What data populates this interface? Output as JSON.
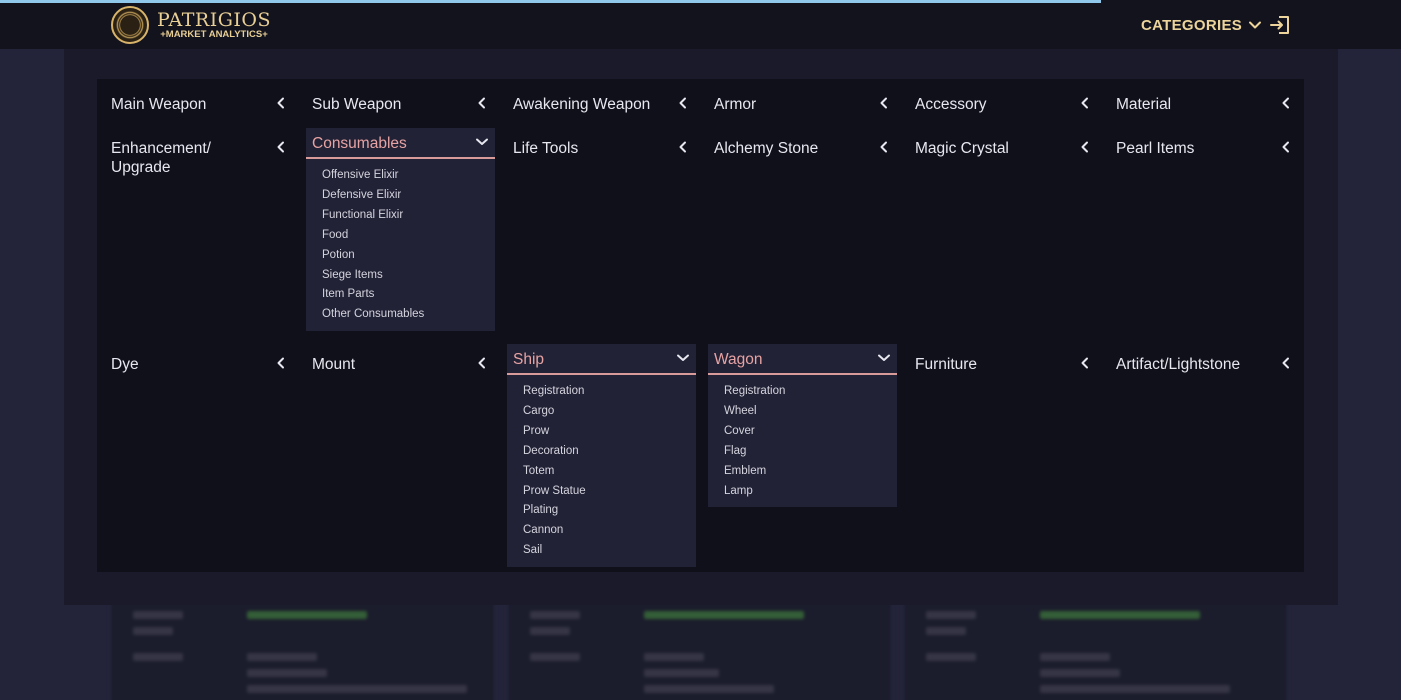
{
  "header": {
    "logo_title": "PATRIGIOS",
    "logo_subtitle": "+MARKET ANALYTICS+",
    "categories_label": "CATEGORIES",
    "progress": 0.786
  },
  "categories": [
    {
      "label": "Main Weapon"
    },
    {
      "label": "Sub Weapon"
    },
    {
      "label": "Awakening Weapon"
    },
    {
      "label": "Armor"
    },
    {
      "label": "Accessory"
    },
    {
      "label": "Material"
    },
    {
      "label": "Enhancement/\nUpgrade"
    },
    {
      "label": "Consumables",
      "open": true,
      "items": [
        "Offensive Elixir",
        "Defensive Elixir",
        "Functional Elixir",
        "Food",
        "Potion",
        "Siege Items",
        "Item Parts",
        "Other Consumables"
      ]
    },
    {
      "label": "Life Tools"
    },
    {
      "label": "Alchemy Stone"
    },
    {
      "label": "Magic Crystal"
    },
    {
      "label": "Pearl Items"
    },
    {
      "label": "Dye"
    },
    {
      "label": "Mount"
    },
    {
      "label": "Ship",
      "open": true,
      "items": [
        "Registration",
        "Cargo",
        "Prow",
        "Decoration",
        "Totem",
        "Prow Statue",
        "Plating",
        "Cannon",
        "Sail"
      ]
    },
    {
      "label": "Wagon",
      "open": true,
      "items": [
        "Registration",
        "Wheel",
        "Cover",
        "Flag",
        "Emblem",
        "Lamp"
      ]
    },
    {
      "label": "Furniture"
    },
    {
      "label": "Artifact/Lightstone"
    }
  ],
  "colors": {
    "accent": "#ecd49b",
    "open_label": "#e7a3a3",
    "progress_bar": "#8fc8ea"
  },
  "icons": {
    "collapsed": "chevron-left-icon",
    "expanded": "chevron-down-icon",
    "logout": "logout-icon"
  }
}
